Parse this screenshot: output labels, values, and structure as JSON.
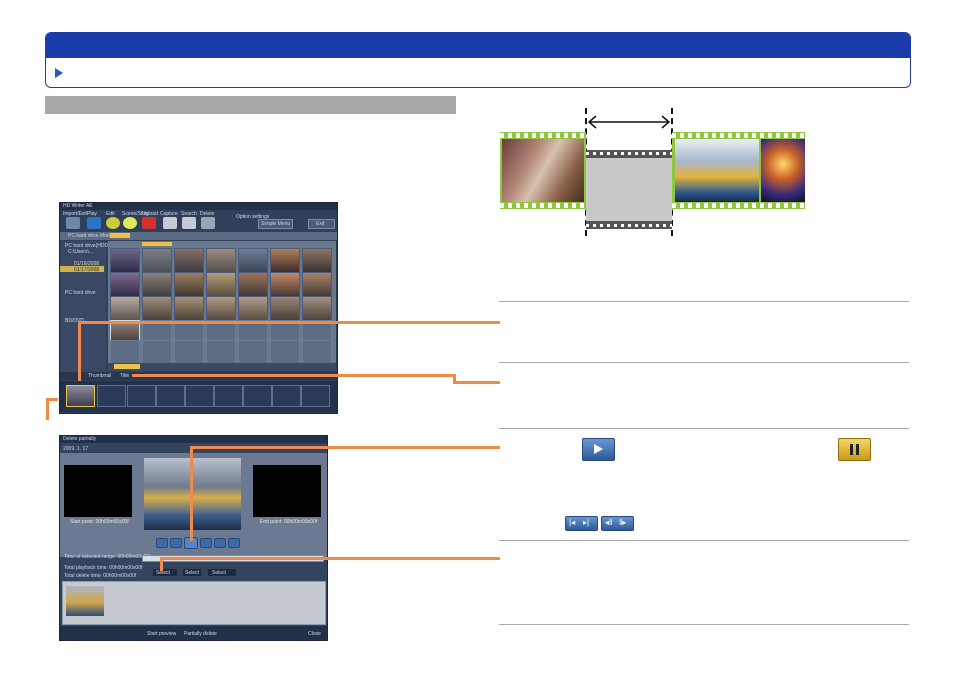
{
  "window1": {
    "title": "HD Writer AE",
    "toolbar": [
      "Import/Exit",
      "Play",
      "Edit",
      "Scene/Story",
      "Upload",
      "Capture",
      "Search",
      "Delete"
    ],
    "right_labels": [
      "Option settings",
      "Simple Menu",
      "Exit"
    ],
    "mode_label": "PC hard drive Mode",
    "folders": [
      "PC hard drive(HDD)",
      "C:\\Users\\...",
      "01/16/2008",
      "01/16/2009",
      "01/17/2008",
      "PC hard drive",
      "BD/DVD"
    ],
    "thumb_caption": "0:00:13",
    "bottom_labels": [
      "Thumbnail",
      "Title",
      "Details",
      "List",
      "Total"
    ],
    "filmstrip_label": "Playlist"
  },
  "window2": {
    "title": "Delete partially",
    "date": "2009. 1. 17",
    "start_label": "Start point: 00h00m00s00f",
    "end_label": "End point: 00h00m00s00f",
    "range_label": "Time of selected range: 00h00m00s00f",
    "total_playback": "Total playback time: 00h00m00s00f",
    "total_delete": "Total delete time: 00h00m00s00f",
    "btn_prev": "Select",
    "btn_select": "Select",
    "btn_next": "Select",
    "footer_left": "Start preview",
    "footer_mid": "Partially delete",
    "footer_close": "Close"
  }
}
